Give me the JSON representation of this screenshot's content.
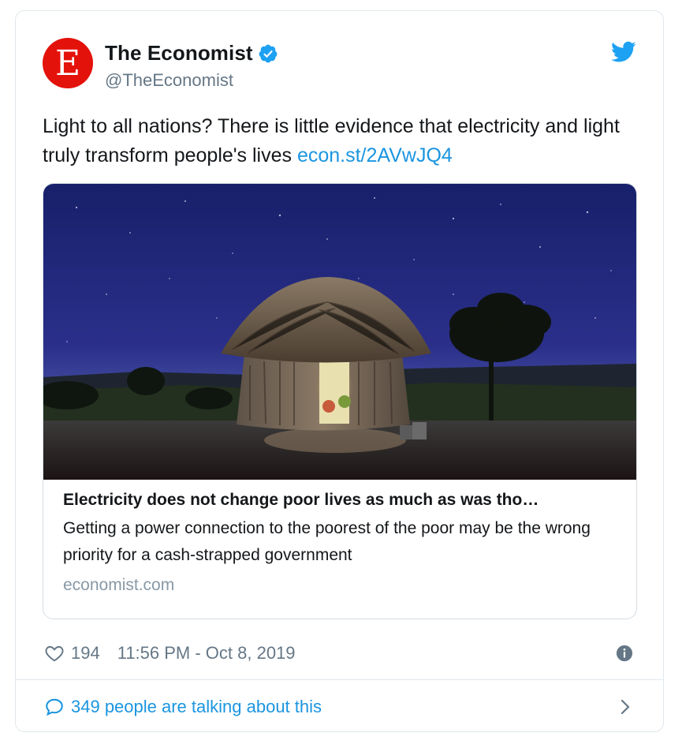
{
  "author": {
    "display_name": "The Economist",
    "handle": "@TheEconomist",
    "avatar_letter": "E",
    "avatar_color": "#e3120b",
    "verified": true
  },
  "tweet": {
    "text": "Light to all nations? There is little evidence that electricity and light truly transform people's lives ",
    "link_text": "econ.st/2AVwJQ4"
  },
  "card": {
    "image_description": "thatched-hut-at-night",
    "title": "Electricity does not change poor lives as much as was tho…",
    "description": "Getting a power connection to the poorest of the poor may be the wrong priority for a cash-strapped government",
    "domain": "economist.com"
  },
  "meta": {
    "likes": "194",
    "timestamp": "11:56 PM - Oct 8, 2019"
  },
  "footer": {
    "talking_text": "349 people are talking about this"
  },
  "colors": {
    "link": "#1b95e0",
    "secondary_text": "#657786",
    "twitter_blue": "#1da1f2",
    "border": "#e1e8ed"
  },
  "icons": {
    "verified": "verified-badge-icon",
    "brand": "twitter-bird-icon",
    "like": "heart-icon",
    "info": "info-icon",
    "conversation": "chat-bubble-icon",
    "navigate": "chevron-right-icon"
  }
}
